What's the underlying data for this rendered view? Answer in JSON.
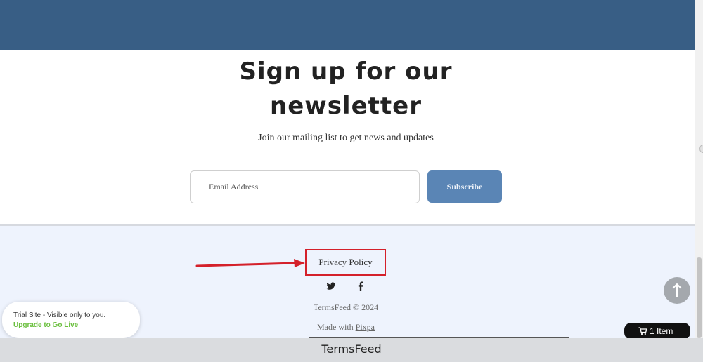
{
  "newsletter": {
    "title_line1": "Sign up for our",
    "title_line2": "newsletter",
    "subtitle": "Join our mailing list to get news and updates",
    "email_placeholder": "Email Address",
    "subscribe_label": "Subscribe"
  },
  "footer": {
    "privacy_link": "Privacy Policy",
    "social_icons": [
      "twitter-icon",
      "facebook-icon"
    ],
    "copyright": "TermsFeed © 2024",
    "made_with_prefix": "Made with ",
    "made_with_link": "Pixpa"
  },
  "trial_badge": {
    "line1": "Trial Site - Visible only to you.",
    "line2": "Upgrade to Go Live"
  },
  "cart": {
    "label": "1 Item"
  },
  "annotation": {
    "highlight_color": "#d4202a"
  },
  "caption": "TermsFeed",
  "colors": {
    "banner": "#385e85",
    "subscribe_button": "#5a85b5",
    "footer_bg": "#eef3fd",
    "trial_link": "#6abf3d"
  }
}
